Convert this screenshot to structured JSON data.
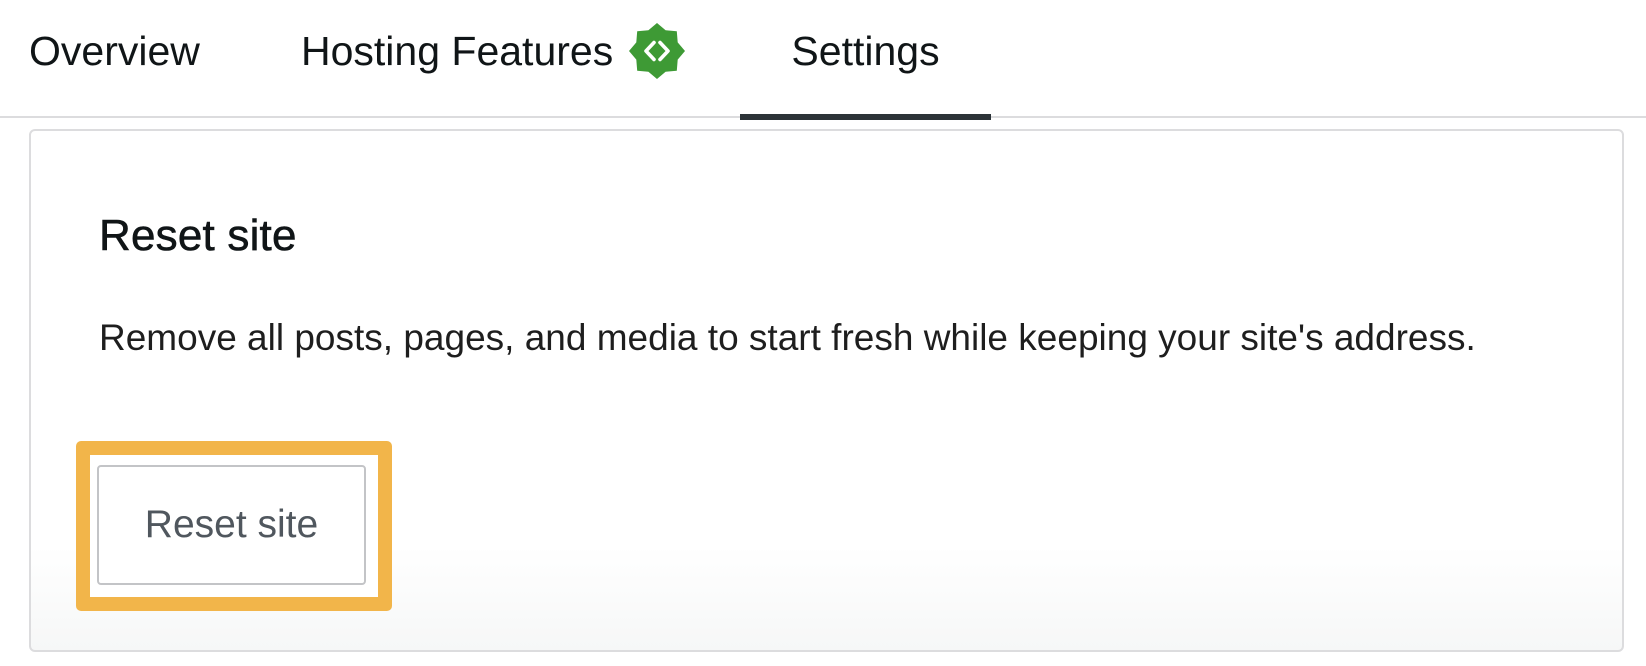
{
  "tabs": {
    "overview": {
      "label": "Overview"
    },
    "hosting_features": {
      "label": "Hosting Features",
      "icon": "code-brackets-badge-icon",
      "badge_color": "#3e9a35"
    },
    "settings": {
      "label": "Settings",
      "selected": true
    }
  },
  "reset_card": {
    "title": "Reset site",
    "description": "Remove all posts, pages, and media to start fresh while keeping your site's address.",
    "button_label": "Reset site",
    "highlight_color": "#f2b54a"
  }
}
